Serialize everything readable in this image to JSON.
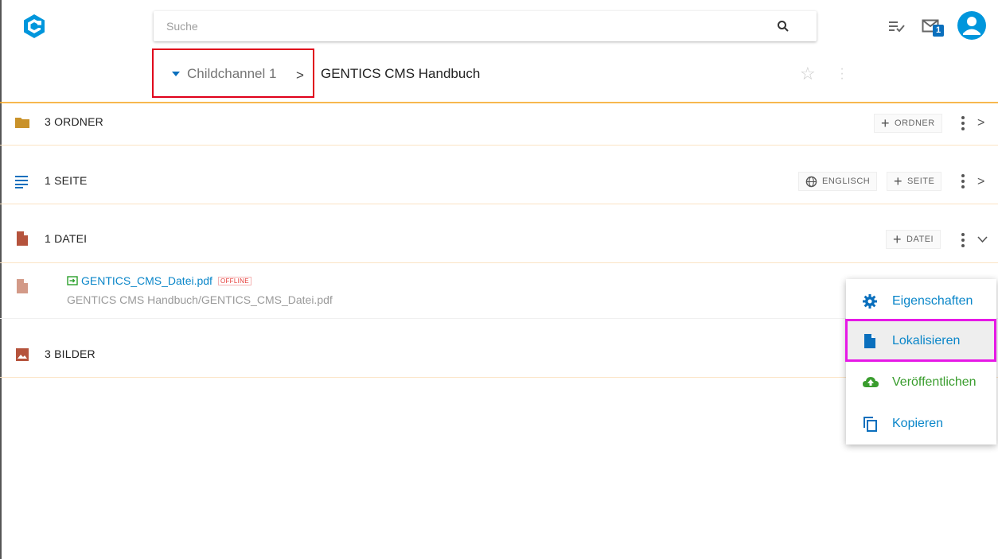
{
  "header": {
    "search_placeholder": "Suche",
    "notification_count": "1"
  },
  "breadcrumb": {
    "channel": "Childchannel 1",
    "separator": ">",
    "title": "GENTICS CMS Handbuch"
  },
  "sections": {
    "folders": {
      "label": "3 ORDNER",
      "add_label": "ORDNER"
    },
    "pages": {
      "label": "1 SEITE",
      "language_label": "ENGLISCH",
      "add_label": "SEITE"
    },
    "files": {
      "label": "1 DATEI",
      "add_label": "DATEI"
    },
    "images": {
      "label": "3 BILDER"
    }
  },
  "file_item": {
    "name": "GENTICS_CMS_Datei.pdf",
    "status_badge": "OFFLINE",
    "path": "GENTICS CMS Handbuch/GENTICS_CMS_Datei.pdf"
  },
  "context_menu": {
    "items": [
      {
        "label": "Eigenschaften",
        "icon": "gear-icon",
        "color": "#0a86c9"
      },
      {
        "label": "Lokalisieren",
        "icon": "file-icon",
        "color": "#0a86c9"
      },
      {
        "label": "Veröffentlichen",
        "icon": "cloud-upload-icon",
        "color": "#3a9d2e"
      },
      {
        "label": "Kopieren",
        "icon": "copy-icon",
        "color": "#0a86c9"
      }
    ]
  },
  "colors": {
    "brand": "#0096dc",
    "accent_orange": "#f5a623",
    "highlight_red": "#e0001b",
    "highlight_pink": "#e619e6"
  }
}
